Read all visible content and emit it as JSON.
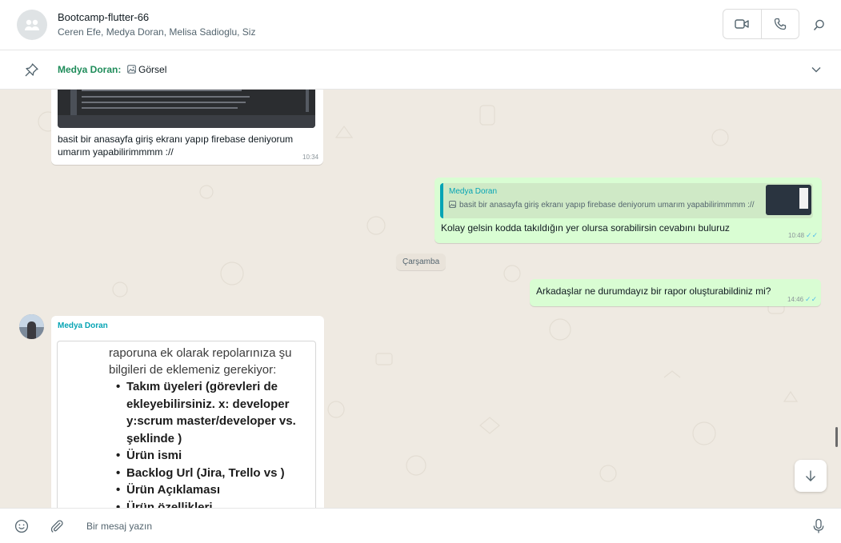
{
  "header": {
    "title": "Bootcamp-flutter-66",
    "members": "Ceren Efe, Medya Doran, Melisa Sadioglu, Siz"
  },
  "pinned": {
    "sender": "Medya Doran:",
    "text": "Görsel"
  },
  "messages": [
    {
      "text": "basit bir anasayfa giriş ekranı yapıp firebase deniyorum umarım yapabilirimmmm ://",
      "time": "10:34"
    },
    {
      "quote_sender": "Medya Doran",
      "quote_text": "basit bir anasayfa giriş ekranı yapıp firebase deniyorum umarım yapabilirimmmm ://",
      "text": "Kolay gelsin kodda takıldığın yer olursa sorabilirsin cevabını buluruz",
      "time": "10:48"
    },
    {
      "text": "Arkadaşlar ne durumdayız bir rapor oluşturabildiniz mi?",
      "time": "14:46"
    },
    {
      "sender": "Medya Doran",
      "image_intro": "raporuna ek olarak repolarınıza şu bilgileri de eklemeniz gerekiyor:",
      "image_items": [
        "Takım üyeleri (görevleri de ekleyebilirsiniz. x: developer y:scrum master/developer vs. şeklinde )",
        "Ürün ismi",
        "Backlog Url (Jira, Trello vs )",
        "Ürün Açıklaması",
        "Ürün özellikleri"
      ]
    }
  ],
  "date_divider": "Çarşamba",
  "composer": {
    "placeholder": "Bir mesaj yazın",
    "value": ""
  },
  "colors": {
    "outgoing_bubble": "#d9fdd3",
    "incoming_bubble": "#ffffff",
    "chat_background": "#efeae2",
    "pinned_sender": "#1f8c5a",
    "quote_accent": "#06a4b4",
    "read_ticks": "#53bdeb"
  },
  "icons": [
    "group-avatar-icon",
    "video-call-icon",
    "voice-call-icon",
    "search-icon",
    "pin-icon",
    "image-icon",
    "chevron-down-icon",
    "double-check-icon",
    "arrow-down-icon",
    "emoji-icon",
    "paperclip-icon",
    "microphone-icon"
  ]
}
